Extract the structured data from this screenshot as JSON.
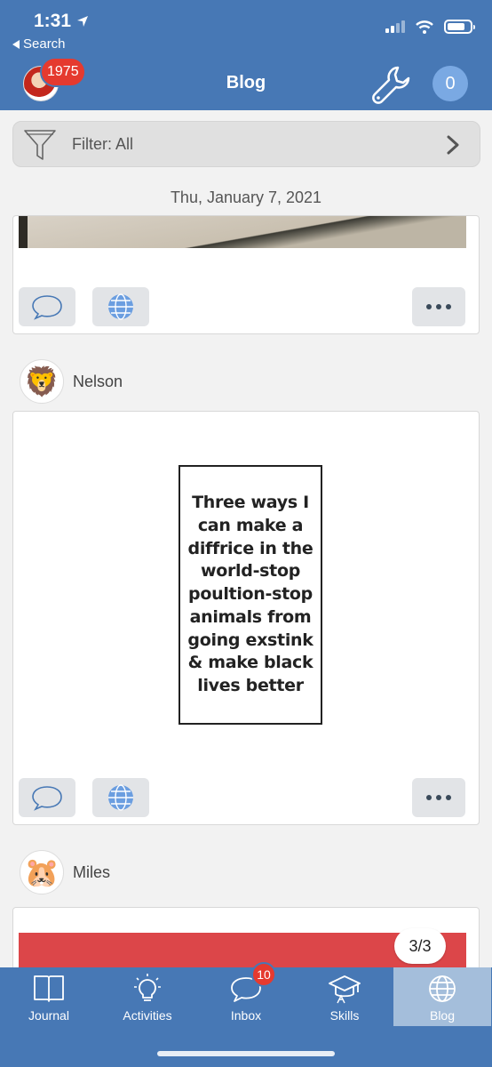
{
  "status_bar": {
    "time": "1:31",
    "back_label": "Search"
  },
  "header": {
    "title": "Blog",
    "profile_badge": "1975",
    "notification_count": "0"
  },
  "filter": {
    "label": "Filter: All"
  },
  "date_header": "Thu, January 7, 2021",
  "posts": [
    {
      "author": "",
      "avatar": "photo-fragment"
    },
    {
      "author": "Nelson",
      "avatar": "lion-emoji",
      "avatar_glyph": "🦁",
      "image_text": "Three ways I can make a diffrice in the world-stop poultion-stop animals from going exstink & make black lives better"
    },
    {
      "author": "Miles",
      "avatar": "hamster-emoji",
      "avatar_glyph": "🐹"
    }
  ],
  "pager": "3/3",
  "tabs": [
    {
      "label": "Journal",
      "icon": "book-icon"
    },
    {
      "label": "Activities",
      "icon": "lightbulb-icon"
    },
    {
      "label": "Inbox",
      "icon": "chat-bubble-icon",
      "badge": "10"
    },
    {
      "label": "Skills",
      "icon": "graduation-cap-icon"
    },
    {
      "label": "Blog",
      "icon": "globe-icon",
      "active": true
    }
  ],
  "colors": {
    "header_bg": "#4778b5",
    "badge_red": "#e53a2f",
    "active_tab": "#a4bedb",
    "button_bg": "#e2e4e7"
  }
}
